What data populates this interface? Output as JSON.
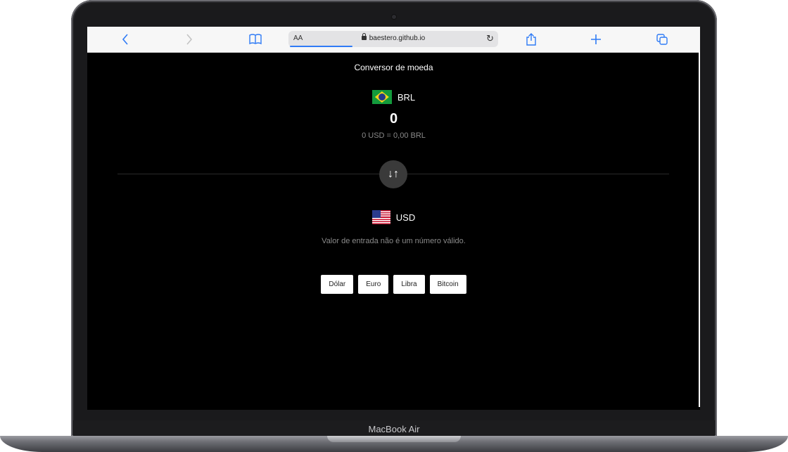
{
  "device": {
    "model_label": "MacBook Air"
  },
  "browser": {
    "aa_label": "AA",
    "url": "baestero.github.io",
    "icons": [
      "back-icon",
      "forward-icon",
      "bookmarks-icon",
      "lock-icon",
      "reload-icon",
      "share-icon",
      "new-tab-icon",
      "tabs-icon"
    ],
    "accent_color": "#2f7bf6"
  },
  "app": {
    "title": "Conversor de moeda",
    "from_currency": {
      "code": "BRL",
      "flag_icon": "brazil-flag-icon"
    },
    "amount": "0",
    "rate_text": "0 USD = 0,00 BRL",
    "to_currency": {
      "code": "USD",
      "flag_icon": "us-flag-icon"
    },
    "error_message": "Valor de entrada não é um número válido.",
    "currency_buttons": [
      "Dólar",
      "Euro",
      "Libra",
      "Bitcoin"
    ]
  }
}
